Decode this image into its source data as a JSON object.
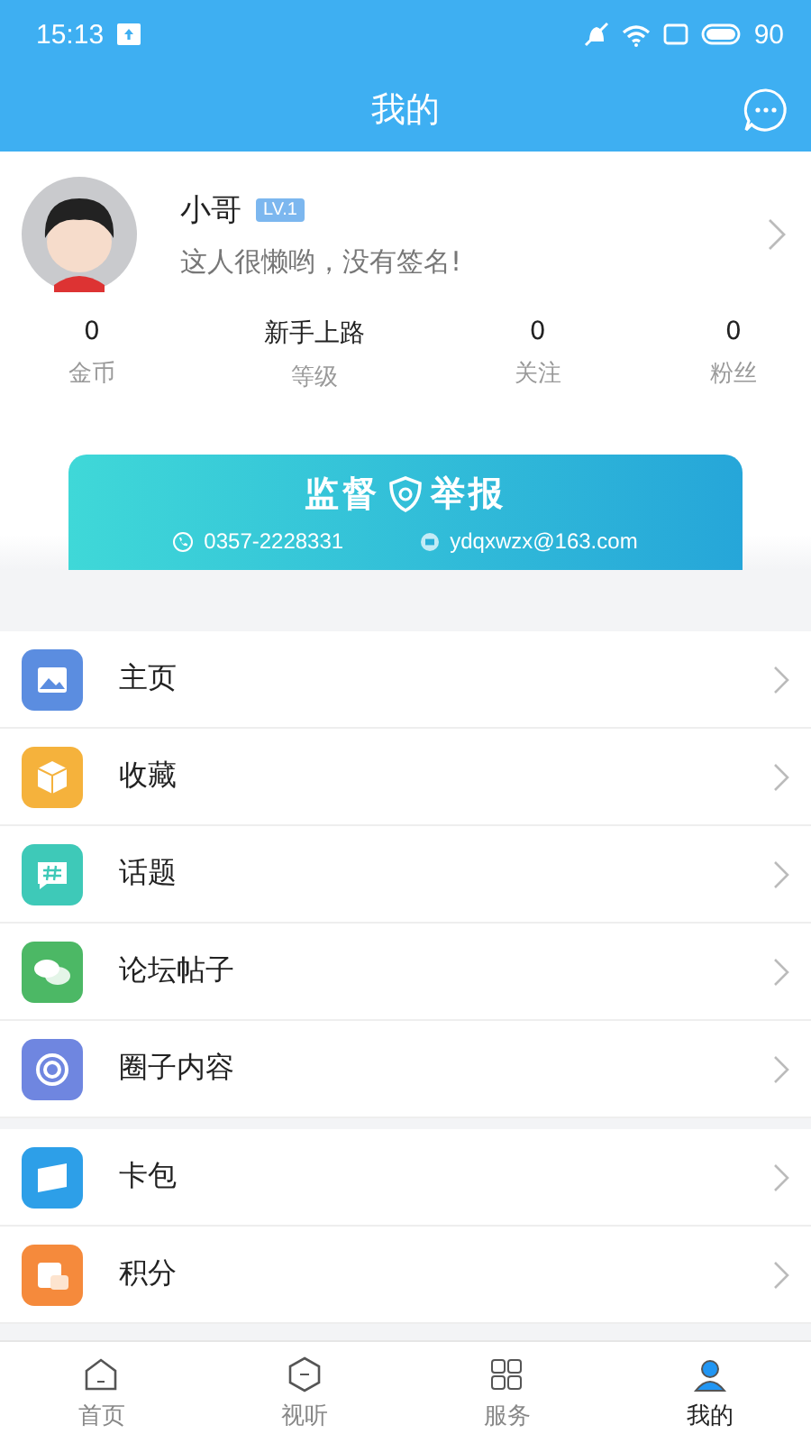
{
  "status_bar": {
    "time": "15:13",
    "battery": "90"
  },
  "header": {
    "title": "我的"
  },
  "profile": {
    "name": "小哥",
    "level_badge": "LV.1",
    "signature": "这人很懒哟，没有签名!"
  },
  "stats": [
    {
      "value": "0",
      "label": "金币"
    },
    {
      "value": "新手上路",
      "label": "等级"
    },
    {
      "value": "0",
      "label": "关注"
    },
    {
      "value": "0",
      "label": "粉丝"
    }
  ],
  "banner": {
    "title_left": "监督",
    "title_right": "举报",
    "phone": "0357-2228331",
    "email": "ydqxwzx@163.com"
  },
  "menu_groups": [
    [
      {
        "label": "主页",
        "kind": "image",
        "color": "#5b8de0"
      },
      {
        "label": "收藏",
        "kind": "box",
        "color": "#f5b23c"
      },
      {
        "label": "话题",
        "kind": "hash",
        "color": "#3ec9b8"
      },
      {
        "label": "论坛帖子",
        "kind": "chat",
        "color": "#4cb865"
      },
      {
        "label": "圈子内容",
        "kind": "circle",
        "color": "#6f86e0"
      }
    ],
    [
      {
        "label": "卡包",
        "kind": "card",
        "color": "#2d9fe8"
      },
      {
        "label": "积分",
        "kind": "coins",
        "color": "#f58a3c"
      }
    ]
  ],
  "tabs": [
    {
      "label": "首页",
      "kind": "home",
      "selected": false
    },
    {
      "label": "视听",
      "kind": "play",
      "selected": false
    },
    {
      "label": "服务",
      "kind": "service",
      "selected": false
    },
    {
      "label": "我的",
      "kind": "me",
      "selected": true
    }
  ]
}
